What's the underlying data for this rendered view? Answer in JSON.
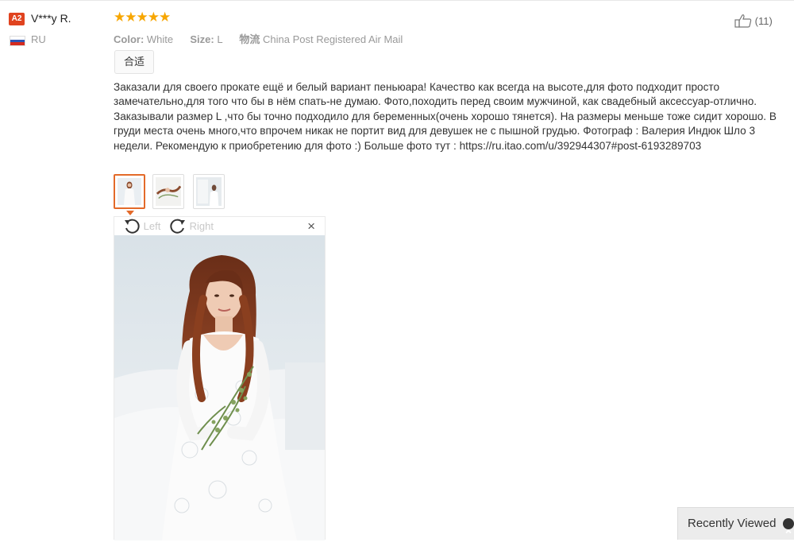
{
  "reviewer": {
    "level_badge": "A2",
    "name": "V***y R.",
    "country": "RU",
    "flag_colors": [
      "#ffffff",
      "#2d55b4",
      "#d52b1e"
    ]
  },
  "rating": {
    "stars": 5,
    "display": "★★★★★",
    "color": "#f7a600"
  },
  "attributes": {
    "color_label": "Color:",
    "color_value": "White",
    "size_label": "Size:",
    "size_value": "L",
    "shipping_label": "物流",
    "shipping_value": "China Post Registered Air Mail"
  },
  "fit_tag": "合适",
  "helpful": {
    "icon": "thumbs-up-icon",
    "count": "(11)"
  },
  "review_text": "Заказали для своего прокате ещё и белый вариант пеньюара! Качество как всегда на высоте,для фото подходит просто замечательно,для того что бы в нём спать-не думаю. Фото,походить перед своим мужчиной, как свадебный аксессуар-отлично. Заказывали размер L ,что бы точно подходило для беременных(очень хорошо тянется). На размеры меньше тоже сидит хорошо. В груди места очень много,что впрочем никак не портит вид для девушек не с пышной грудью. Фотограф : Валерия Индюк Шло 3 недели. Рекомендую к приобретению для фото :) Больше фото тут : https://ru.itao.com/u/392944307#post-6193289703",
  "thumbnails": [
    {
      "name": "review-thumbnail-1",
      "active": true
    },
    {
      "name": "review-thumbnail-2",
      "active": false
    },
    {
      "name": "review-thumbnail-3",
      "active": false
    }
  ],
  "viewer": {
    "rotate_left_label": "Left",
    "rotate_right_label": "Right",
    "close_symbol": "×"
  },
  "recently_viewed": {
    "label": "Recently Viewed",
    "icon": "chevron-up-icon"
  },
  "accent_color": "#e36a2a"
}
